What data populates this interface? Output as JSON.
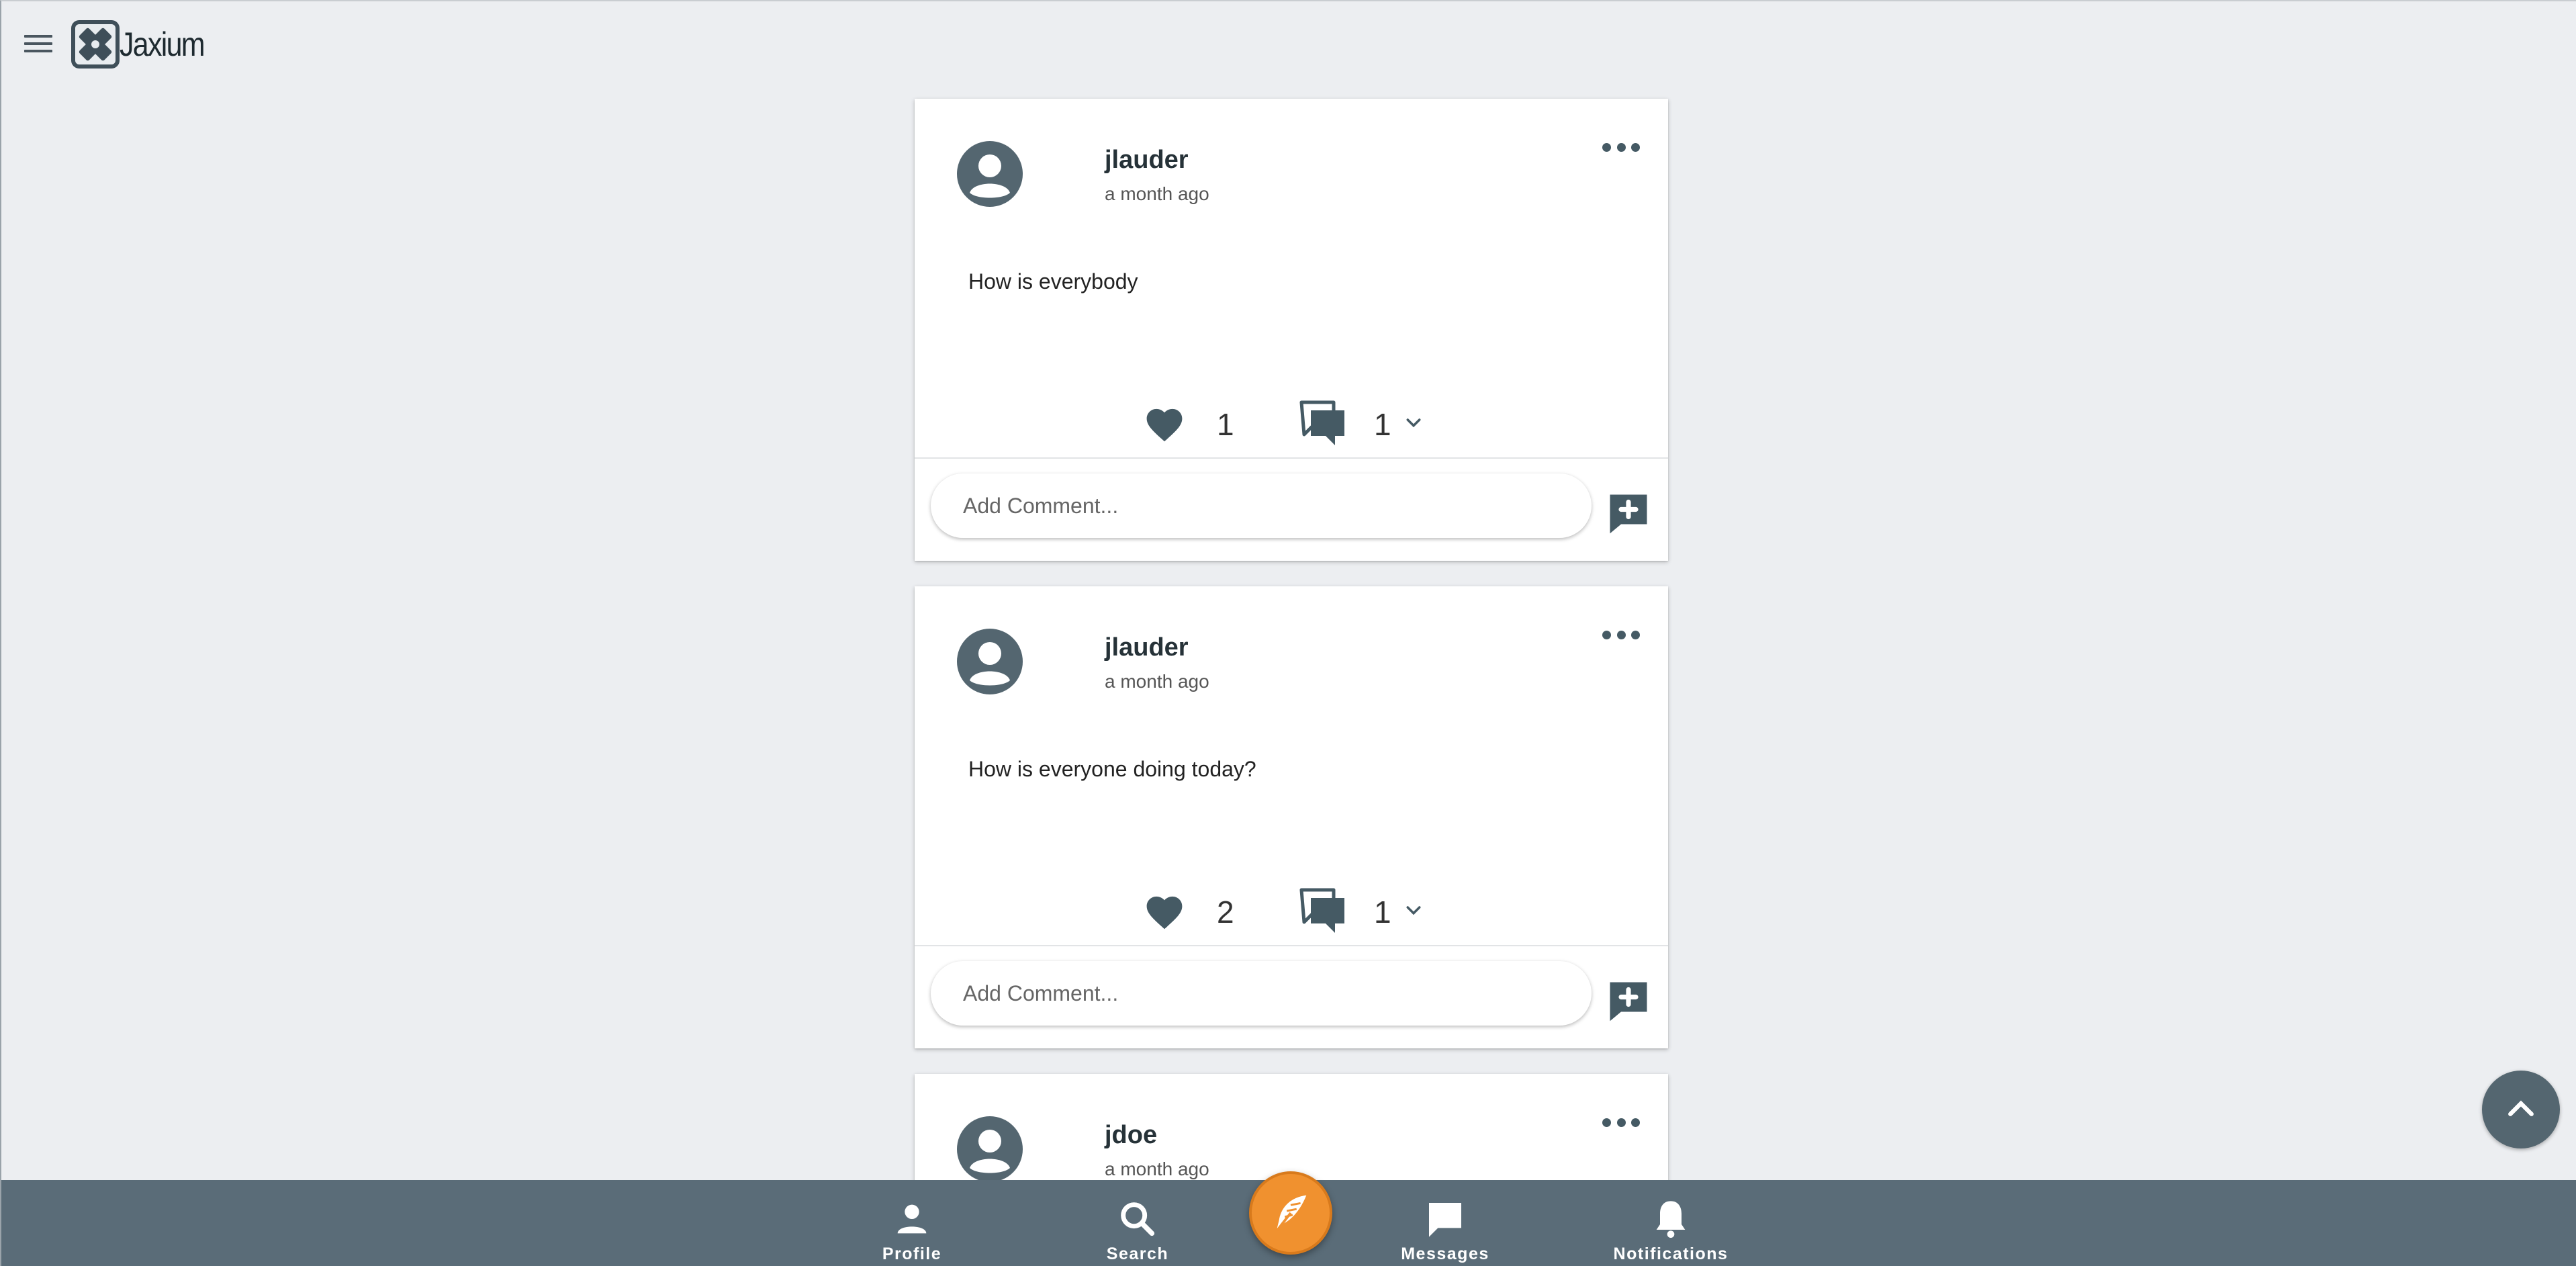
{
  "app": {
    "name": "Jaxium"
  },
  "colors": {
    "nav_bg": "#5a6c78",
    "fab": "#f0912f",
    "icon": "#455a64",
    "page_bg": "#eceef1"
  },
  "posts": [
    {
      "username": "jlauder",
      "time": "a month ago",
      "body": "How is everybody",
      "likes": "1",
      "comments": "1",
      "comment_placeholder": "Add Comment..."
    },
    {
      "username": "jlauder",
      "time": "a month ago",
      "body": "How is everyone doing today?",
      "likes": "2",
      "comments": "1",
      "comment_placeholder": "Add Comment..."
    },
    {
      "username": "jdoe",
      "time": "a month ago"
    }
  ],
  "nav": {
    "profile": "Profile",
    "search": "Search",
    "messages": "Messages",
    "notifications": "Notifications"
  },
  "icons": {
    "menu": "hamburger-menu-icon",
    "avatar": "account-circle-icon",
    "more": "more-horizontal-icon",
    "like": "heart-icon",
    "comment": "comment-bubbles-icon",
    "expand": "chevron-down-icon",
    "add_comment": "add-comment-icon",
    "scroll_top": "chevron-up-icon",
    "compose": "feather-quill-icon"
  }
}
